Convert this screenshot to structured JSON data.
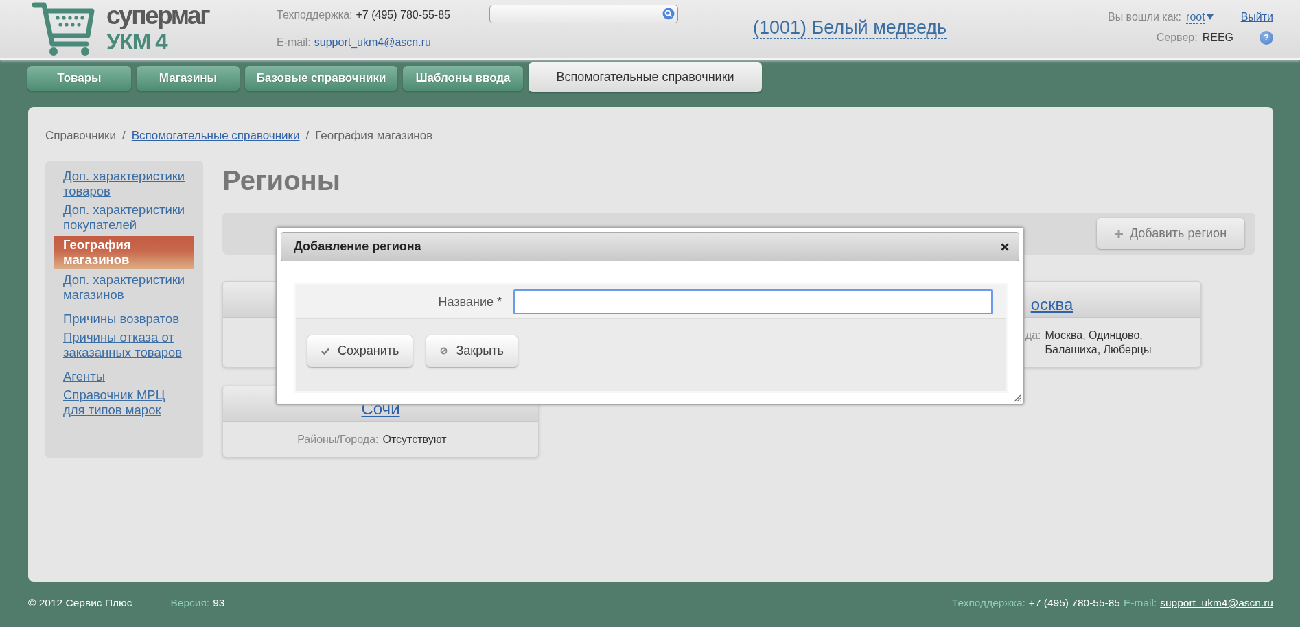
{
  "header": {
    "logo": {
      "line_1": "супермаг",
      "line_2": "УКМ 4"
    },
    "support": {
      "phone_label": "Техподдержка:",
      "phone": "+7 (495) 780-55-85",
      "email_label": "E-mail:",
      "email": "support_ukm4@ascn.ru"
    },
    "store": "(1001) Белый медведь",
    "user": {
      "label": "Вы вошли как:",
      "name": "root",
      "logout": "Выйти",
      "server_label": "Сервер:",
      "server": "REEG",
      "help": "?"
    }
  },
  "tabs": [
    {
      "label": "Товары",
      "selected": false
    },
    {
      "label": "Магазины",
      "selected": false
    },
    {
      "label": "Базовые справочники",
      "selected": false
    },
    {
      "label": "Шаблоны ввода",
      "selected": false
    },
    {
      "label": "Вспомогательные справочники",
      "selected": true
    }
  ],
  "breadcrumb": {
    "items": [
      {
        "label": "Справочники",
        "link": false
      },
      {
        "label": "Вспомогательные справочники",
        "link": true
      },
      {
        "label": "География магазинов",
        "link": false
      }
    ],
    "separators": [
      "/",
      "/"
    ]
  },
  "sidebar": {
    "items": [
      {
        "label": "Доп. характеристики товаров",
        "selected": false
      },
      {
        "label": "Доп. характеристики покупателей",
        "selected": false
      },
      {
        "label": "География магазинов",
        "selected": true
      },
      {
        "label": "Доп. характеристики магазинов",
        "selected": false
      },
      {
        "label": "Причины возвратов",
        "selected": false
      },
      {
        "label": "Причины отказа от заказанных товаров",
        "selected": false
      },
      {
        "label": "Агенты",
        "selected": false
      },
      {
        "label": "Справочник МРЦ для типов марок",
        "selected": false
      }
    ]
  },
  "page_title": "Регионы",
  "toolbar": {
    "add_button": "Добавить регион"
  },
  "cards": [
    {
      "kind": "covered"
    },
    {
      "kind": "hidden"
    },
    {
      "kind": "partial",
      "title": "осква",
      "label": "да:",
      "value": "Москва, Одинцово, Балашиха, Люберцы"
    },
    {
      "kind": "region",
      "title": "Сочи",
      "label": "Районы/Города:",
      "value": "Отсутствуют"
    }
  ],
  "dialog": {
    "title": "Добавление региона",
    "field_label": "Название *",
    "buttons": [
      {
        "kind": "save",
        "label": "Сохранить"
      },
      {
        "kind": "close",
        "label": "Закрыть"
      }
    ]
  },
  "footer": {
    "copyright": "© 2012 Сервис Плюс",
    "version_label": "Версия:",
    "version": "93",
    "support_label": "Техподдержка:",
    "phone": "+7 (495) 780-55-85",
    "email_label": "E-mail:",
    "email": "support_ukm4@ascn.ru"
  }
}
